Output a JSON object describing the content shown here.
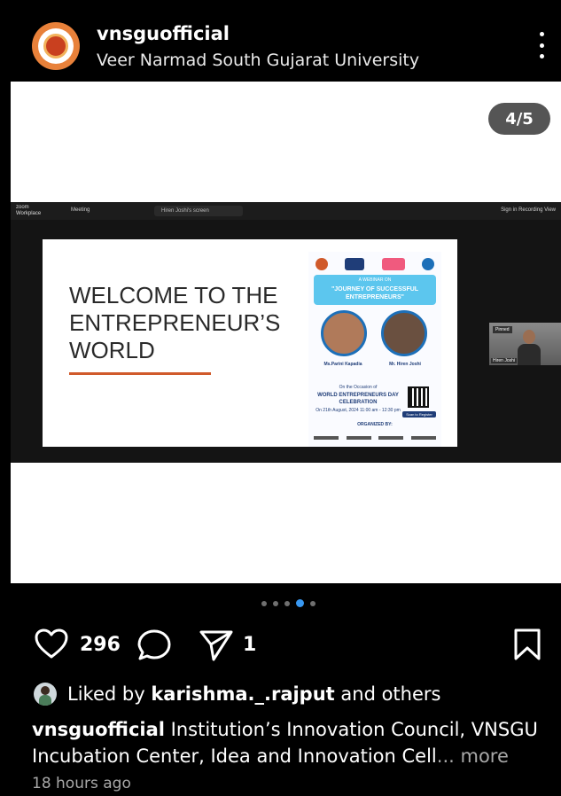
{
  "post": {
    "username": "vnsguofficial",
    "account_name": "Veer Narmad South Gujarat University",
    "slide_counter": "4/5",
    "likes_count": "296",
    "shares_count": "1",
    "liked_by_prefix": "Liked by ",
    "liked_by_user": "karishma._.rajput",
    "liked_by_suffix": " and others",
    "caption_user": "vnsguofficial",
    "caption_text": " Institution’s Innovation Council, VNSGU Incubation Center, Idea and Innovation Cell",
    "caption_more": "... more",
    "timestamp": "18 hours ago",
    "carousel": {
      "count": 5,
      "active": 4
    }
  },
  "media": {
    "zoom_brand": "zoom Workplace",
    "zoom_meeting": "Meeting",
    "zoom_share": "Hiren Joshi's screen",
    "zoom_right": "Sign in   Recording   View",
    "slide_heading": "WELCOME TO THE ENTREPRENEUR’S WORLD",
    "poster_webinar": "A WEBINAR ON",
    "poster_title": "\"JOURNEY OF SUCCESSFUL ENTREPRENEURS\"",
    "speaker1": "Ms.Parini Kapadia",
    "speaker2": "Mr. Hiren Joshi",
    "poster_occasion": "On the Occasion of",
    "poster_event": "WORLD ENTREPRENEURS DAY CELEBRATION",
    "poster_date": "On 21th August, 2024 11:00 am - 12:30 pm",
    "poster_register": "Scan to Register",
    "poster_org": "ORGANIZED BY:",
    "cam_tag": "Pinned",
    "cam_label": "Hiren Joshi"
  },
  "icons": {
    "more": "more-vertical-icon",
    "like": "heart-outline-icon",
    "comment": "comment-bubble-icon",
    "share": "send-paper-plane-icon",
    "save": "bookmark-outline-icon"
  },
  "colors": {
    "background": "#000000",
    "accent": "#3897f0",
    "avatar": "#e8813a",
    "slide_underline": "#d05a2b"
  }
}
